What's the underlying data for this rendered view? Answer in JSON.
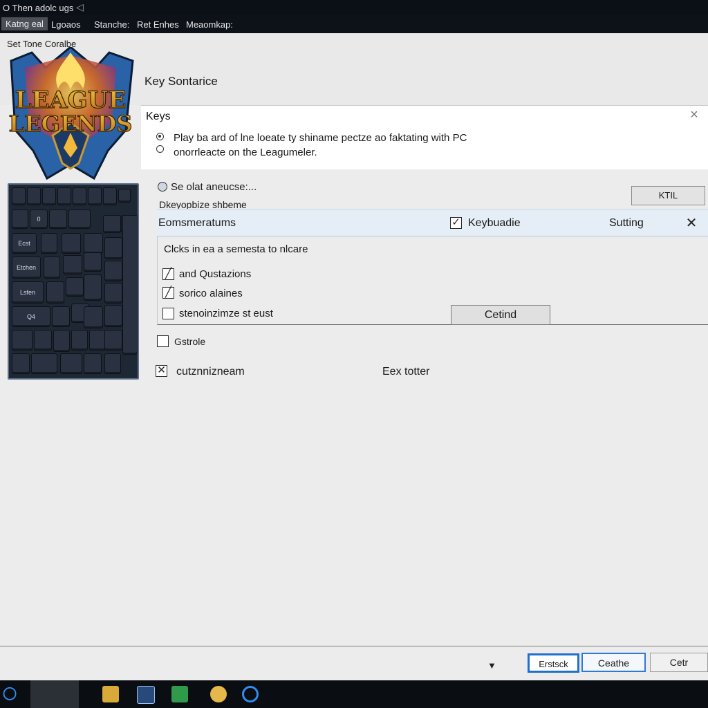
{
  "window": {
    "title": "O Then adolc ugs"
  },
  "menu": {
    "items": [
      "Katng eal",
      "Lgoaos",
      "Stanche:",
      "Ret Enhes",
      "Meaomkap:"
    ]
  },
  "header": {
    "set_tone": "Set Tone Coralbe",
    "section_title": "Key Sontarice"
  },
  "logo": {
    "text_line1": "LEAGUE",
    "text_line2": "LEGENDS"
  },
  "keys_panel": {
    "title": "Keys",
    "options": [
      {
        "label": "Play ba ard of lne loeate ty shiname pectze ao faktating with PC",
        "selected": true
      },
      {
        "label": "onorrleacte on the Leagumeler.",
        "selected": false
      }
    ]
  },
  "keyboard": {
    "labels": [
      "0",
      "Ecst",
      "Etchen",
      "Lsfen",
      "Q4"
    ]
  },
  "select_row": {
    "label": "Se olat aneucse:...",
    "sub_label": "Dkeyopbize shbeme",
    "button_label": "KTIL"
  },
  "inner_dialog": {
    "title": "Eomsmeratums",
    "keyboard_toggle_label": "Keybuadie",
    "keyboard_toggle_checked": true,
    "setting_label": "Sutting",
    "instructions": "Clcks in ea a semesta to nlcare",
    "checkboxes": [
      {
        "label": "and Qustazions",
        "checked": true
      },
      {
        "label": "sorico alaines",
        "checked": true
      },
      {
        "label": "stenoinzimze st eust",
        "checked": false
      }
    ],
    "action_button": "Cetind"
  },
  "options_extra": [
    {
      "label": "Gstrole",
      "checked": false
    },
    {
      "label": "cutznnizneam",
      "checked": true
    }
  ],
  "extra_text": "Eex totter",
  "footer": {
    "buttons": [
      "Erstsck",
      "Ceathe",
      "Cetr"
    ]
  },
  "colors": {
    "accent": "#1f6fd1",
    "taskbar": "#0a0d12",
    "dialog_header": "#e5eef7"
  }
}
